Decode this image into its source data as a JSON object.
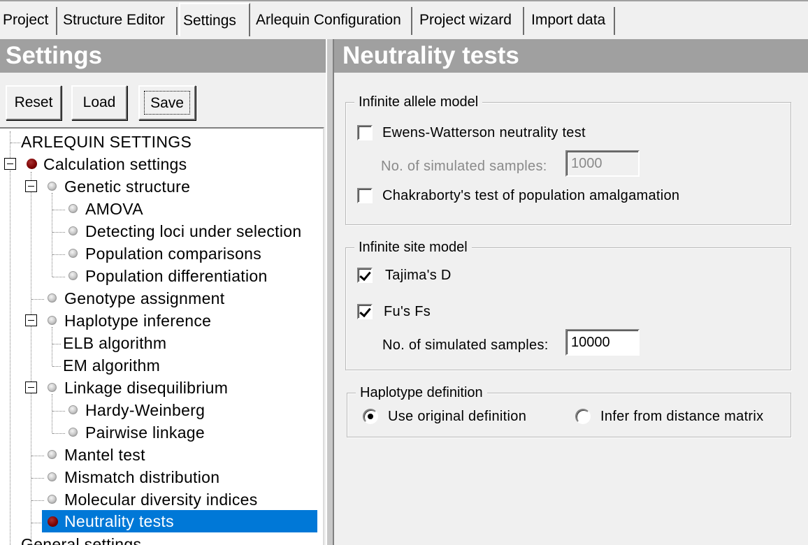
{
  "tabs": [
    {
      "label": "Project"
    },
    {
      "label": "Structure Editor"
    },
    {
      "label": "Settings",
      "active": true
    },
    {
      "label": "Arlequin Configuration"
    },
    {
      "label": "Project wizard"
    },
    {
      "label": "Import data"
    }
  ],
  "left_panel": {
    "title": "Settings",
    "buttons": {
      "reset": "Reset",
      "load": "Load",
      "save": "Save"
    },
    "tree": [
      {
        "label": "ARLEQUIN SETTINGS"
      },
      {
        "label": "Calculation settings",
        "icon": "dark-red-dot-icon",
        "expanded": true
      },
      {
        "label": "Genetic structure",
        "icon": "gray-dot-icon",
        "expanded": true
      },
      {
        "label": "AMOVA",
        "icon": "gray-dot-icon"
      },
      {
        "label": "Detecting loci under selection",
        "icon": "gray-dot-icon"
      },
      {
        "label": "Population comparisons",
        "icon": "gray-dot-icon"
      },
      {
        "label": "Population differentiation",
        "icon": "gray-dot-icon"
      },
      {
        "label": "Genotype assignment",
        "icon": "gray-dot-icon"
      },
      {
        "label": "Haplotype inference",
        "icon": "gray-dot-icon",
        "expanded": true
      },
      {
        "label": "ELB algorithm"
      },
      {
        "label": "EM algorithm"
      },
      {
        "label": "Linkage disequilibrium",
        "icon": "gray-dot-icon",
        "expanded": true
      },
      {
        "label": "Hardy-Weinberg",
        "icon": "gray-dot-icon"
      },
      {
        "label": "Pairwise linkage",
        "icon": "gray-dot-icon"
      },
      {
        "label": "Mantel test",
        "icon": "gray-dot-icon"
      },
      {
        "label": "Mismatch distribution",
        "icon": "gray-dot-icon"
      },
      {
        "label": "Molecular diversity indices",
        "icon": "gray-dot-icon"
      },
      {
        "label": "Neutrality tests",
        "icon": "dark-red-dot-icon",
        "selected": true
      },
      {
        "label": "General settings"
      }
    ]
  },
  "right_panel": {
    "title": "Neutrality tests",
    "infinite_allele": {
      "title": "Infinite allele model",
      "ewens_label": "Ewens-Watterson neutrality test",
      "ewens_checked": false,
      "sim_samples_label": "No. of simulated samples:",
      "sim_samples_value": "1000",
      "sim_samples_enabled": false,
      "chakraborty_label": "Chakraborty's test of population amalgamation",
      "chakraborty_checked": false
    },
    "infinite_site": {
      "title": "Infinite site model",
      "tajima_label": "Tajima's D",
      "tajima_checked": true,
      "fu_label": "Fu's Fs",
      "fu_checked": true,
      "sim_samples_label": "No. of simulated samples:",
      "sim_samples_value": "10000"
    },
    "haplotype_definition": {
      "title": "Haplotype definition",
      "option_original": "Use original definition",
      "option_distance": "Infer from distance matrix",
      "selected": "original"
    }
  },
  "colors": {
    "header_bg": "#a0a0a0",
    "header_text": "#ffffff",
    "selection_bg": "#0078d7",
    "window_bg": "#f0f0f0",
    "active_dot": "#7a0000"
  }
}
